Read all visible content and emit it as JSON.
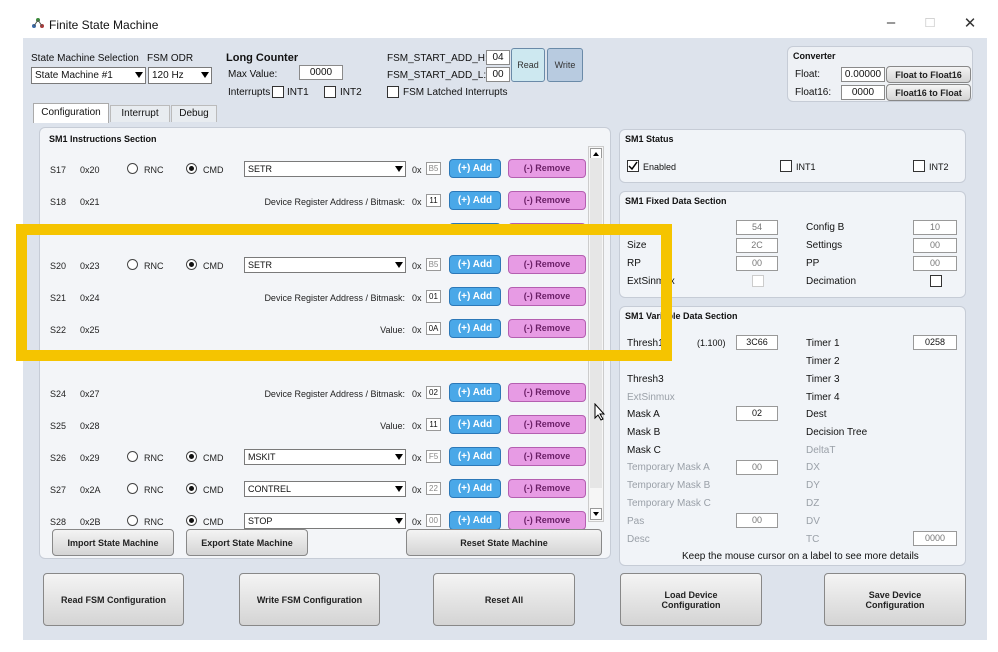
{
  "window": {
    "title": "Finite State Machine",
    "min": "–",
    "max": "□",
    "close": "✕"
  },
  "top": {
    "sm_sel_label": "State Machine Selection",
    "fsm_odr_label": "FSM ODR",
    "sm_value": "State Machine #1",
    "odr_value": "120 Hz",
    "long_counter_title": "Long Counter",
    "max_value_label": "Max Value:",
    "max_value": "0000",
    "interrupts_label": "Interrupts",
    "int1": "INT1",
    "int2": "INT2",
    "start_h_label": "FSM_START_ADD_H:",
    "start_h": "04",
    "start_l_label": "FSM_START_ADD_L:",
    "start_l": "00",
    "read": "Read",
    "write": "Write",
    "latched": "FSM Latched Interrupts",
    "converter_title": "Converter",
    "float_label": "Float:",
    "float_value": "0.00000",
    "float16_label": "Float16:",
    "float16_value": "0000",
    "f2f16": "Float to Float16",
    "f16tof": "Float16 to Float"
  },
  "tabs": [
    "Configuration",
    "Interrupt",
    "Debug"
  ],
  "instr": {
    "title": "SM1 Instructions Section",
    "rnc": "RNC",
    "cmd": "CMD",
    "ox": "0x",
    "add": "(+) Add",
    "remove": "(-) Remove",
    "rows": [
      {
        "s": "S17",
        "a": "0x20",
        "type": "cmd",
        "text": "SETR",
        "hex": "B5"
      },
      {
        "s": "S18",
        "a": "0x21",
        "type": "addr",
        "text": "Device Register Address / Bitmask:",
        "hex": "11"
      },
      {
        "s": "S20",
        "a": "0x23",
        "type": "cmd",
        "text": "SETR",
        "hex": "B5"
      },
      {
        "s": "S21",
        "a": "0x24",
        "type": "addr",
        "text": "Device Register Address / Bitmask:",
        "hex": "01"
      },
      {
        "s": "S22",
        "a": "0x25",
        "type": "addr",
        "text": "Value:",
        "hex": "0A"
      },
      {
        "s": "S24",
        "a": "0x27",
        "type": "addr",
        "text": "Device Register Address / Bitmask:",
        "hex": "02"
      },
      {
        "s": "S25",
        "a": "0x28",
        "type": "addr",
        "text": "Value:",
        "hex": "11"
      },
      {
        "s": "S26",
        "a": "0x29",
        "type": "cmd",
        "text": "MSKIT",
        "hex": "F5"
      },
      {
        "s": "S27",
        "a": "0x2A",
        "type": "cmd",
        "text": "CONTREL",
        "hex": "22"
      },
      {
        "s": "S28",
        "a": "0x2B",
        "type": "cmd",
        "text": "STOP",
        "hex": "00"
      }
    ]
  },
  "buttons": {
    "import": "Import State Machine",
    "export": "Export State Machine",
    "reset_sm": "Reset State Machine",
    "read_fsm": "Read FSM Configuration",
    "write_fsm": "Write FSM Configuration",
    "reset_all": "Reset All",
    "load_dev": "Load Device Configuration",
    "save_dev": "Save Device Configuration"
  },
  "status": {
    "title": "SM1 Status",
    "enabled": "Enabled",
    "int1": "INT1",
    "int2": "INT2"
  },
  "fixed": {
    "title": "SM1 Fixed Data Section",
    "rows": [
      {
        "l": "",
        "v": "54",
        "r": "Config B",
        "rv": "10"
      },
      {
        "l": "Size",
        "v": "2C",
        "r": "Settings",
        "rv": "00"
      },
      {
        "l": "RP",
        "v": "00",
        "r": "PP",
        "rv": "00"
      },
      {
        "l": "ExtSinmux",
        "v": "",
        "r": "Decimation",
        "rv": ""
      }
    ]
  },
  "variable": {
    "title": "SM1 Variable Data Section",
    "thresh1": "Thresh1",
    "thresh1_extra": "(1.100)",
    "thresh1_v": "3C66",
    "left": [
      "Thresh3",
      "ExtSinmux",
      "Mask A",
      "Mask B",
      "Mask C",
      "Temporary Mask A",
      "Temporary Mask B",
      "Temporary Mask C",
      "Pas",
      "Desc"
    ],
    "mask_a_v": "02",
    "tmp_a_v": "00",
    "pas_v": "00",
    "right": [
      "Timer 1",
      "Timer 2",
      "Timer 3",
      "Timer 4",
      "Dest",
      "Decision Tree",
      "DeltaT",
      "DX",
      "DY",
      "DZ",
      "DV",
      "TC"
    ],
    "timer1_v": "0258",
    "tc_v": "0000",
    "hint": "Keep the mouse cursor on a label to see more details"
  },
  "overlay_color": "#f5c400"
}
